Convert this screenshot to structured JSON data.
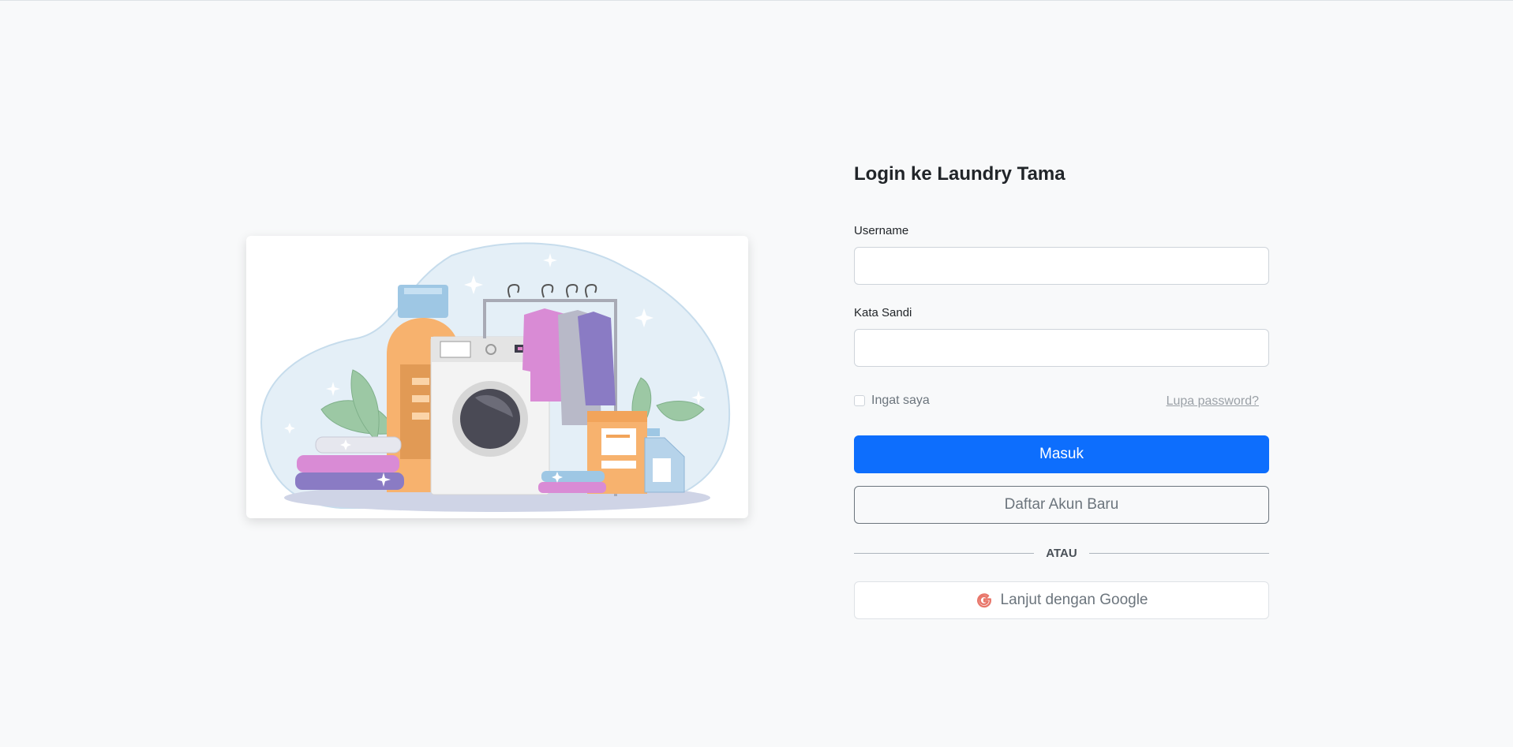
{
  "login": {
    "title": "Login ke Laundry Tama",
    "username_label": "Username",
    "username_value": "",
    "password_label": "Kata Sandi",
    "password_value": "",
    "remember_label": "Ingat saya",
    "remember_checked": false,
    "forgot_link": "Lupa password?",
    "submit_label": "Masuk",
    "register_label": "Daftar Akun Baru",
    "divider_label": "ATAU",
    "google_label": "Lanjut dengan Google",
    "google_icon": "google-g-icon"
  },
  "colors": {
    "background": "#f8f9fa",
    "primary": "#0d6efd",
    "outline": "#6c757d",
    "google_icon": "#e8776b"
  },
  "illustration": {
    "icon": "laundry-illustration"
  }
}
